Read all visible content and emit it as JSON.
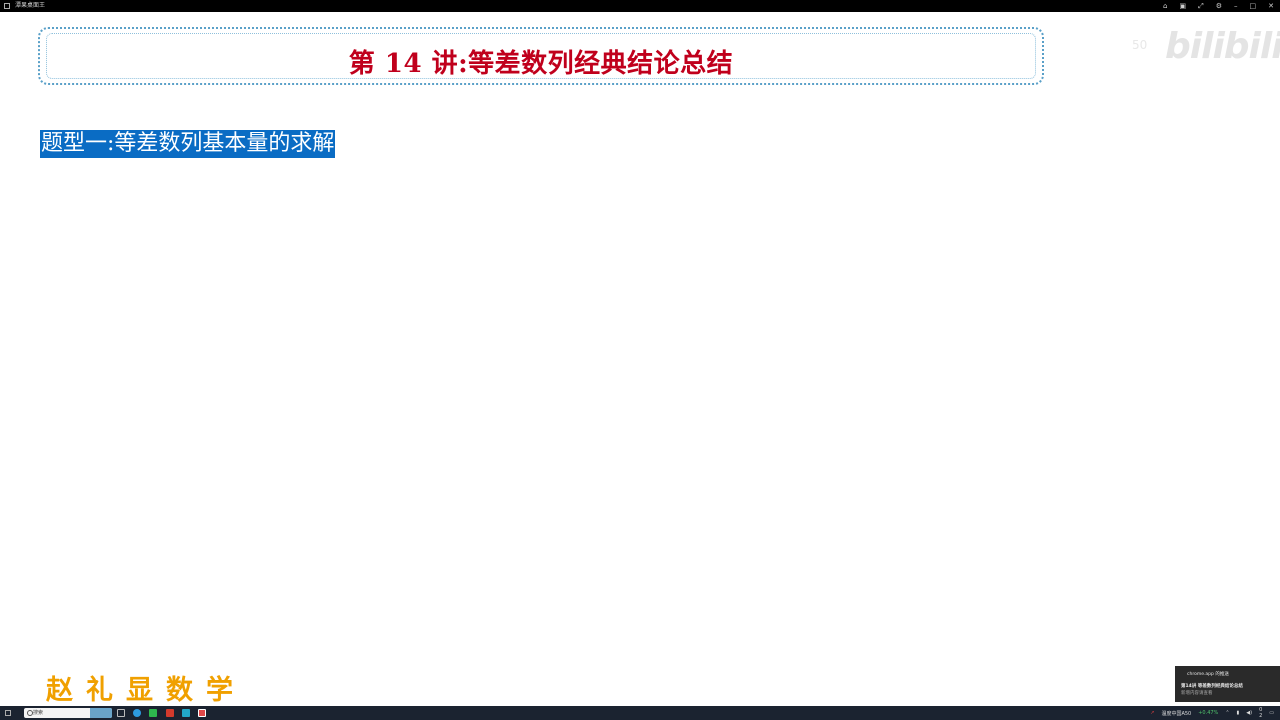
{
  "window": {
    "title": "潭果桌面王"
  },
  "banner": {
    "title": "第 14 讲:等差数列经典结论总结"
  },
  "watermark": {
    "logo": "bilibili",
    "number": "50"
  },
  "content": {
    "heading": "题型一:等差数列基本量的求解"
  },
  "brand": {
    "text": "赵礼显数学"
  },
  "notification": {
    "app": "chrome.app 的推送",
    "title": "第14讲 等差数列经典结论总结",
    "subtitle": "新增内容请查看"
  },
  "taskbar": {
    "search_placeholder": "搜索",
    "weather": "温度中国A50",
    "stock": "+0.47%",
    "time": "0",
    "date": "2"
  },
  "colors": {
    "title_red": "#c0001c",
    "heading_blue": "#0a6cc4",
    "brand_orange": "#f0a000",
    "border_blue": "#5aa0c8"
  }
}
